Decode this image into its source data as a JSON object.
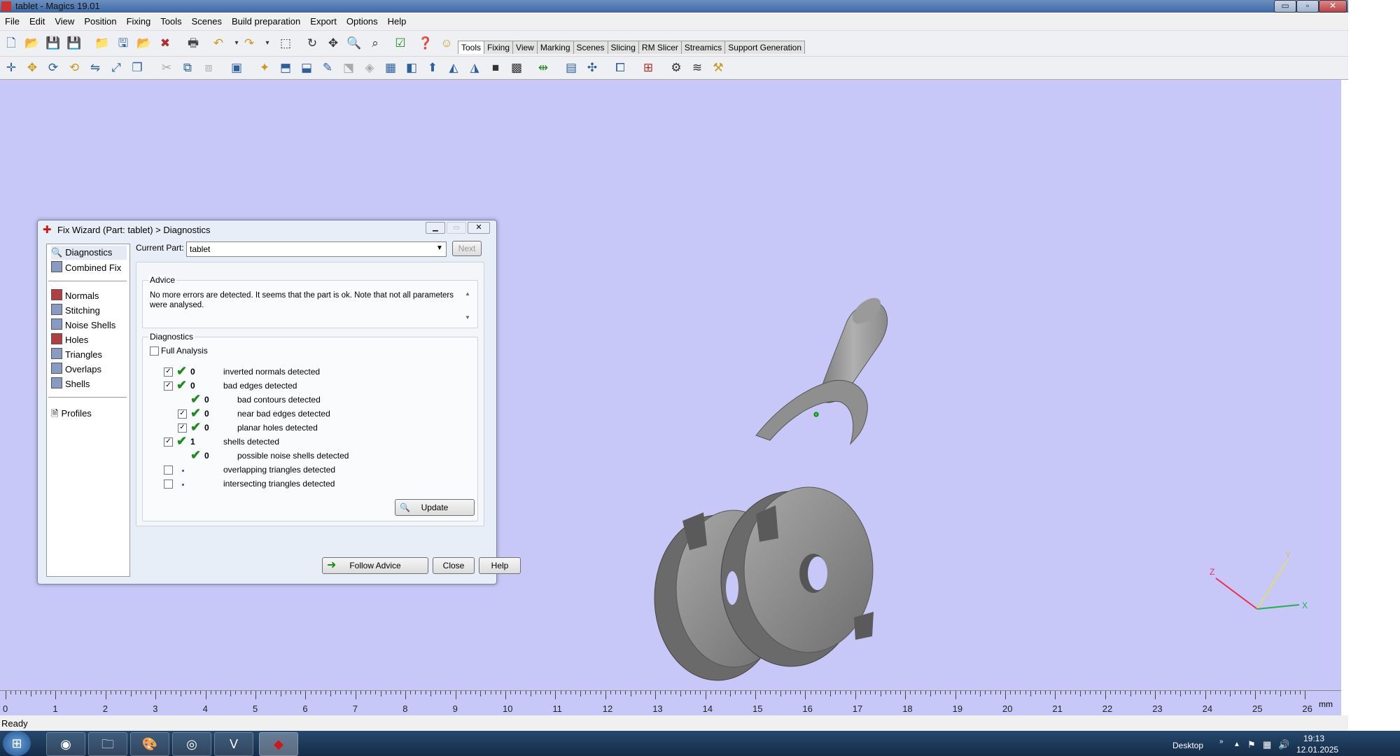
{
  "window": {
    "title": "tablet - Magics 19.01",
    "minimize": "▭",
    "maximize": "▫",
    "close": "✕"
  },
  "menu": [
    "File",
    "Edit",
    "View",
    "Position",
    "Fixing",
    "Tools",
    "Scenes",
    "Build preparation",
    "Export",
    "Options",
    "Help"
  ],
  "ribbon_tabs": [
    "Tools",
    "Fixing",
    "View",
    "Marking",
    "Scenes",
    "Slicing",
    "RM Slicer",
    "Streamics",
    "Support Generation"
  ],
  "active_tab": "Tools",
  "dialog": {
    "title": "Fix Wizard (Part: tablet) > Diagnostics",
    "nav": {
      "diagnostics": "Diagnostics",
      "combined_fix": "Combined Fix",
      "normals": "Normals",
      "stitching": "Stitching",
      "noise_shells": "Noise Shells",
      "holes": "Holes",
      "triangles": "Triangles",
      "overlaps": "Overlaps",
      "shells": "Shells",
      "profiles": "Profiles"
    },
    "current_part_label": "Current Part:",
    "current_part_value": "tablet",
    "next_label": "Next",
    "advice_label": "Advice",
    "advice_text": "No more errors are detected. It seems that the part is ok. Note that not all parameters were analysed.",
    "diagnostics_label": "Diagnostics",
    "full_analysis_label": "Full Analysis",
    "rows": {
      "inverted": {
        "count": "0",
        "label": "inverted normals detected"
      },
      "bad_edges": {
        "count": "0",
        "label": "bad edges detected"
      },
      "bad_contours": {
        "count": "0",
        "label": "bad contours detected"
      },
      "near_bad_edges": {
        "count": "0",
        "label": "near bad edges detected"
      },
      "planar_holes": {
        "count": "0",
        "label": "planar holes detected"
      },
      "shells": {
        "count": "1",
        "label": "shells detected"
      },
      "noise_shells": {
        "count": "0",
        "label": "possible noise shells detected"
      },
      "overlapping": {
        "label": "overlapping triangles detected"
      },
      "intersecting": {
        "label": "intersecting triangles detected"
      }
    },
    "update_label": "Update",
    "follow_advice_label": "Follow Advice",
    "close_label": "Close",
    "help_label": "Help"
  },
  "axes": {
    "z": "Z",
    "y": "Y",
    "x": "X"
  },
  "ruler": {
    "labels": [
      "0",
      "1",
      "2",
      "3",
      "4",
      "5",
      "6",
      "7",
      "8",
      "9",
      "10",
      "11",
      "12",
      "13",
      "14",
      "15",
      "16",
      "17",
      "18",
      "19",
      "20",
      "21",
      "22",
      "23",
      "24",
      "25",
      "26"
    ],
    "unit": "mm"
  },
  "status": "Ready",
  "taskbar": {
    "desktop": "Desktop",
    "time": "19:13",
    "date": "12.01.2025"
  },
  "colors": {
    "viewport": "#c8c8f8",
    "check": "#1e8b1e",
    "part": "#8c8c8c"
  }
}
